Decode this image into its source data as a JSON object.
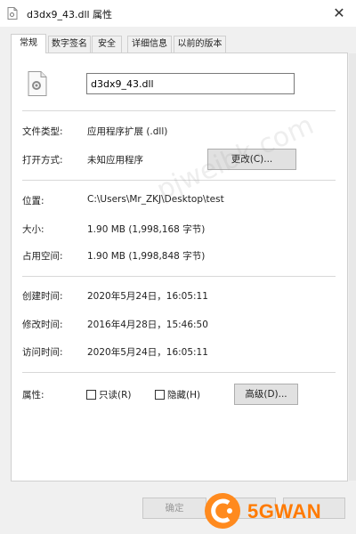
{
  "window": {
    "title": "d3dx9_43.dll 属性",
    "close_glyph": "✕"
  },
  "tabs": [
    {
      "label": "常规",
      "active": true
    },
    {
      "label": "数字签名",
      "active": false
    },
    {
      "label": "安全",
      "active": false
    },
    {
      "label": "详细信息",
      "active": false
    },
    {
      "label": "以前的版本",
      "active": false
    }
  ],
  "general": {
    "filename": "d3dx9_43.dll",
    "file_type_label": "文件类型:",
    "file_type_value": "应用程序扩展 (.dll)",
    "open_with_label": "打开方式:",
    "open_with_value": "未知应用程序",
    "change_button": "更改(C)...",
    "location_label": "位置:",
    "location_value": "C:\\Users\\Mr_ZKJ\\Desktop\\test",
    "size_label": "大小:",
    "size_value": "1.90 MB (1,998,168 字节)",
    "size_on_disk_label": "占用空间:",
    "size_on_disk_value": "1.90 MB (1,998,848 字节)",
    "created_label": "创建时间:",
    "created_value": "2020年5月24日，16:05:11",
    "modified_label": "修改时间:",
    "modified_value": "2016年4月28日，15:46:50",
    "accessed_label": "访问时间:",
    "accessed_value": "2020年5月24日，16:05:11",
    "attributes_label": "属性:",
    "readonly_label": "只读(R)",
    "readonly_checked": false,
    "hidden_label": "隐藏(H)",
    "hidden_checked": false,
    "advanced_button": "高级(D)..."
  },
  "footer": {
    "ok_button": "确定"
  },
  "overlay": {
    "watermark": "pjweibk.com",
    "brand": "5GWAN"
  },
  "colors": {
    "panel_bg": "#ffffff",
    "window_bg": "#f0f0f0",
    "button_bg": "#e1e1e1",
    "brand_orange": "#ff7a00"
  }
}
